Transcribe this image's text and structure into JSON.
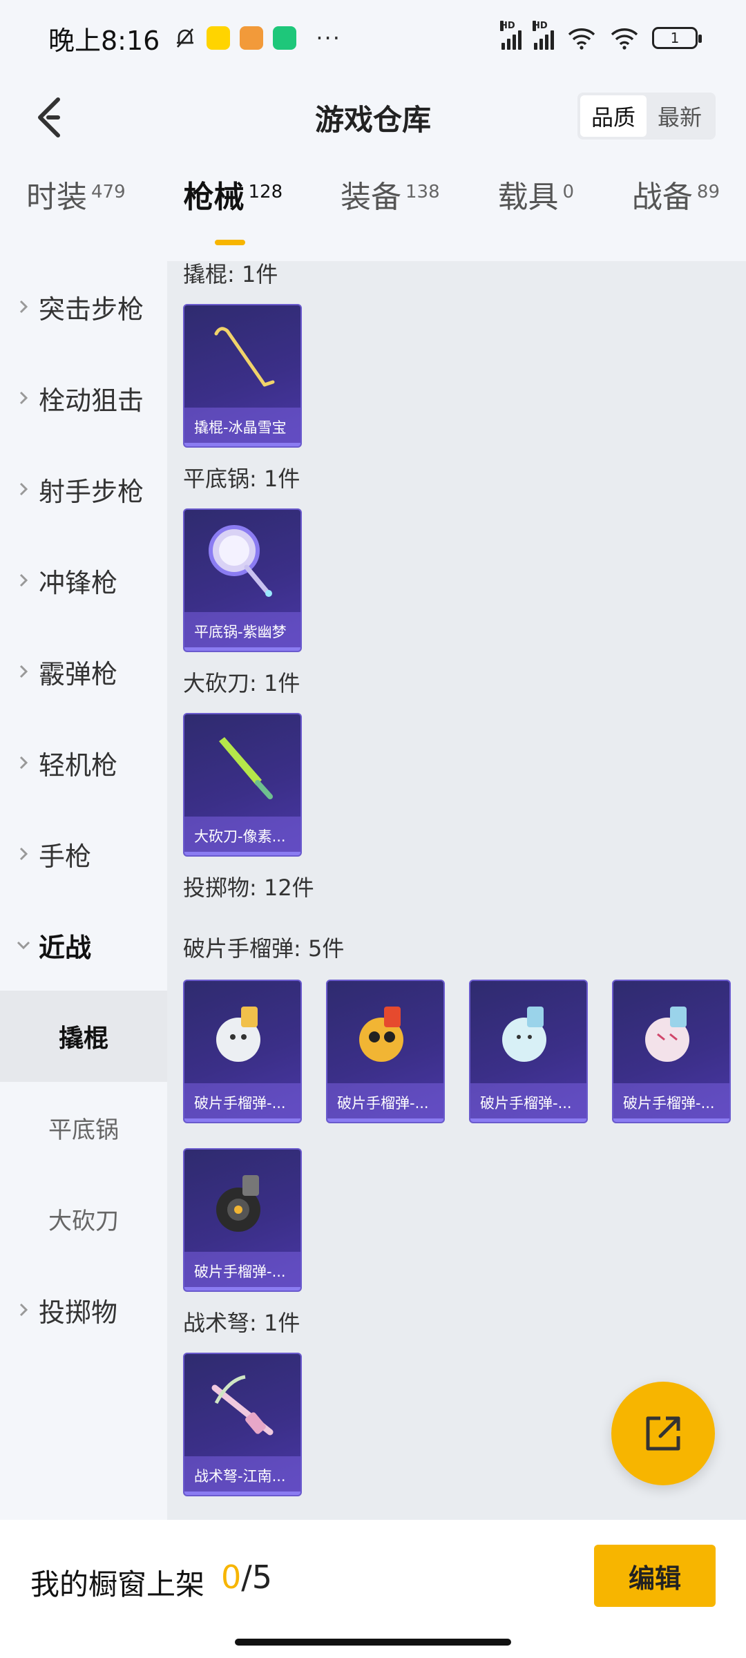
{
  "status_bar": {
    "time": "晚上8:16",
    "dots": "···",
    "battery": "1",
    "signal_hd_1": "HD",
    "signal_hd_2": "HD"
  },
  "header": {
    "title": "游戏仓库",
    "sort_options": [
      "品质",
      "最新"
    ],
    "active_sort": "品质"
  },
  "category_tabs": [
    {
      "label": "时装",
      "count": "479"
    },
    {
      "label": "枪械",
      "count": "128"
    },
    {
      "label": "装备",
      "count": "138"
    },
    {
      "label": "载具",
      "count": "0"
    },
    {
      "label": "战备",
      "count": "89"
    }
  ],
  "active_category": "枪械",
  "sidebar": {
    "items": [
      {
        "label": "突击步枪"
      },
      {
        "label": "栓动狙击"
      },
      {
        "label": "射手步枪"
      },
      {
        "label": "冲锋枪"
      },
      {
        "label": "霰弹枪"
      },
      {
        "label": "轻机枪"
      },
      {
        "label": "手枪"
      },
      {
        "label": "近战"
      },
      {
        "label": "投掷物"
      }
    ],
    "expanded": "近战",
    "sub_items": [
      {
        "label": "撬棍"
      },
      {
        "label": "平底锅"
      },
      {
        "label": "大砍刀"
      }
    ],
    "active_sub": "撬棍"
  },
  "content": {
    "sections": [
      {
        "title": "撬棍: 1件",
        "items": [
          "撬棍-冰晶雪宝"
        ]
      },
      {
        "title": "平底锅: 1件",
        "items": [
          "平底锅-紫幽梦"
        ]
      },
      {
        "title": "大砍刀: 1件",
        "items": [
          "大砍刀-像素..."
        ]
      },
      {
        "title": "投掷物: 12件",
        "items": []
      },
      {
        "title": "破片手榴弹: 5件",
        "items": [
          "破片手榴弹-...",
          "破片手榴弹-...",
          "破片手榴弹-...",
          "破片手榴弹-...",
          "破片手榴弹-..."
        ]
      },
      {
        "title": "战术弩: 1件",
        "items": [
          "战术弩-江南..."
        ]
      }
    ]
  },
  "bottom_bar": {
    "showcase_label": "我的橱窗上架",
    "showcase_current": "0",
    "showcase_total": "/5",
    "edit_label": "编辑"
  },
  "colors": {
    "accent": "#f7b500",
    "card_bg": "#3b2f88"
  }
}
